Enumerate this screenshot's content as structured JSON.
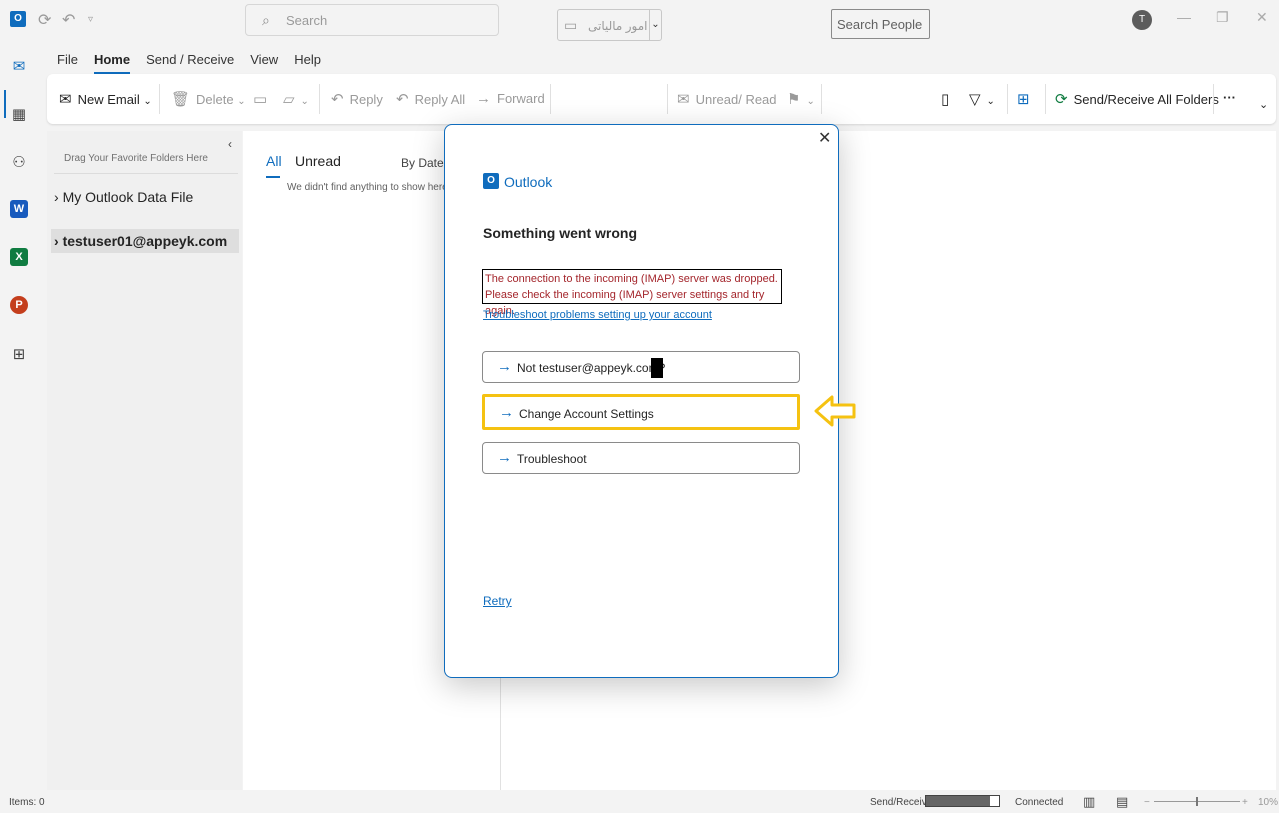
{
  "titlebar": {
    "search_placeholder": "Search",
    "avatar_initial": "T"
  },
  "menu": {
    "tabs": [
      "File",
      "Home",
      "Send / Receive",
      "View",
      "Help"
    ],
    "active": "Home"
  },
  "ribbon": {
    "new_email": "New Email",
    "delete": "Delete",
    "reply": "Reply",
    "reply_all": "Reply All",
    "forward": "Forward",
    "category_select": "امور مالیاتی",
    "unread_read": "Unread/ Read",
    "search_people": "Search People",
    "send_receive_all": "Send/Receive All Folders"
  },
  "folders": {
    "fav_hint": "Drag Your Favorite Folders Here",
    "items": [
      "My Outlook Data File",
      "testuser01@appeyk.com"
    ]
  },
  "message_list": {
    "tab_all": "All",
    "tab_unread": "Unread",
    "sort": "By Date",
    "empty": "We didn't find anything to show here."
  },
  "dialog": {
    "brand": "Outlook",
    "title": "Something went wrong",
    "error_text": "The connection to the incoming (IMAP) server was dropped. Please check the incoming (IMAP) server settings and try again.",
    "troubleshoot_link": "Troubleshoot problems setting up your account",
    "options": [
      "Not testuser@appeyk.com?",
      "Change Account Settings",
      "Troubleshoot"
    ],
    "retry": "Retry",
    "highlight_color": "#f5c211"
  },
  "status": {
    "items": "Items: 0",
    "send_receive": "Send/Receive",
    "send_receive_progress": 0.88,
    "connected": "Connected",
    "zoom": "10%"
  }
}
